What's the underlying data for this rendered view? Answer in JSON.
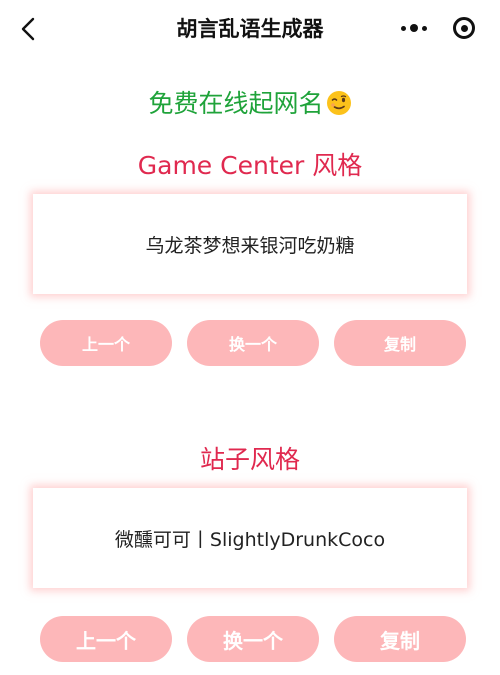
{
  "navbar": {
    "title": "胡言乱语生成器",
    "back_icon": "chevron-left-icon",
    "more_icon": "more-dots-icon",
    "close_icon": "target-circle-icon"
  },
  "headline": {
    "text": "免费在线起网名",
    "emoji": "winking-face"
  },
  "sections": [
    {
      "title": "Game Center 风格",
      "result": "乌龙茶梦想来银河吃奶糖",
      "buttons": {
        "prev": "上一个",
        "swap": "换一个",
        "copy": "复制"
      }
    },
    {
      "title": "站子风格",
      "result": "微醺可可丨SlightlyDrunkCoco",
      "buttons": {
        "prev": "上一个",
        "swap": "换一个",
        "copy": "复制"
      }
    }
  ],
  "colors": {
    "headline": "#1fa33a",
    "section_title": "#e0294f",
    "button_bg": "#fdb7b9",
    "button_text": "#ffffff",
    "card_glow": "#ffaaaa"
  }
}
